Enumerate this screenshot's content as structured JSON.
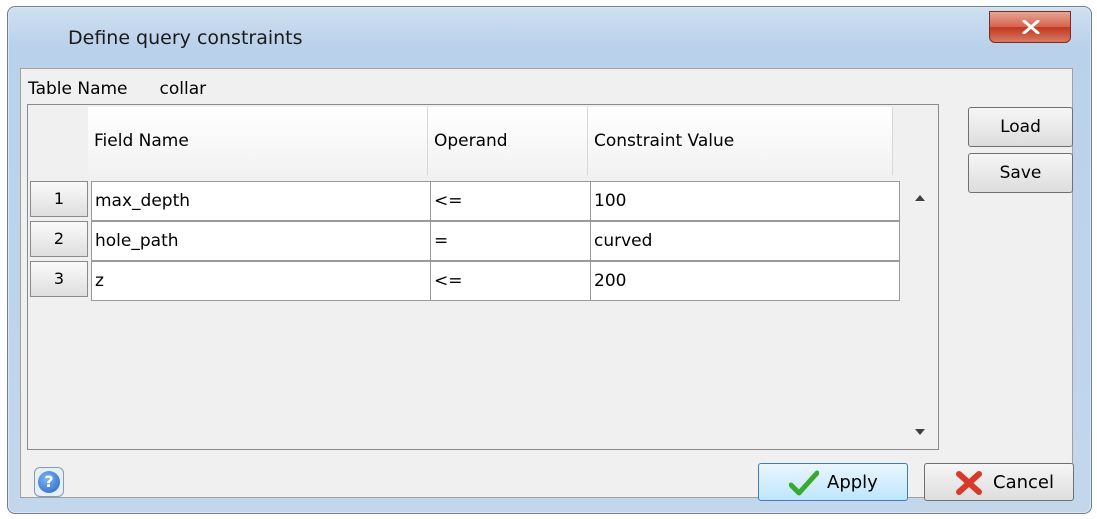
{
  "window": {
    "title": "Define query constraints"
  },
  "table": {
    "name_label": "Table Name",
    "name_value": "collar"
  },
  "grid": {
    "headers": [
      "Field Name",
      "Operand",
      "Constraint Value"
    ],
    "rows": [
      {
        "num": "1",
        "field": "max_depth",
        "operand": "<=",
        "value": "100"
      },
      {
        "num": "2",
        "field": "hole_path",
        "operand": "=",
        "value": "curved"
      },
      {
        "num": "3",
        "field": "z",
        "operand": "<=",
        "value": "200"
      }
    ]
  },
  "side": {
    "load_label": "Load",
    "save_label": "Save"
  },
  "footer": {
    "help_label": "?",
    "apply_label": "Apply",
    "cancel_label": "Cancel"
  },
  "colors": {
    "apply_check": "#3aa92f",
    "cancel_x": "#d83a2a",
    "close_button": "#c9462f"
  },
  "icons": {
    "close": "close-icon",
    "help": "help-icon",
    "apply": "checkmark-icon",
    "cancel": "x-icon",
    "scroll_up": "arrow-up-icon",
    "scroll_down": "arrow-down-icon"
  }
}
